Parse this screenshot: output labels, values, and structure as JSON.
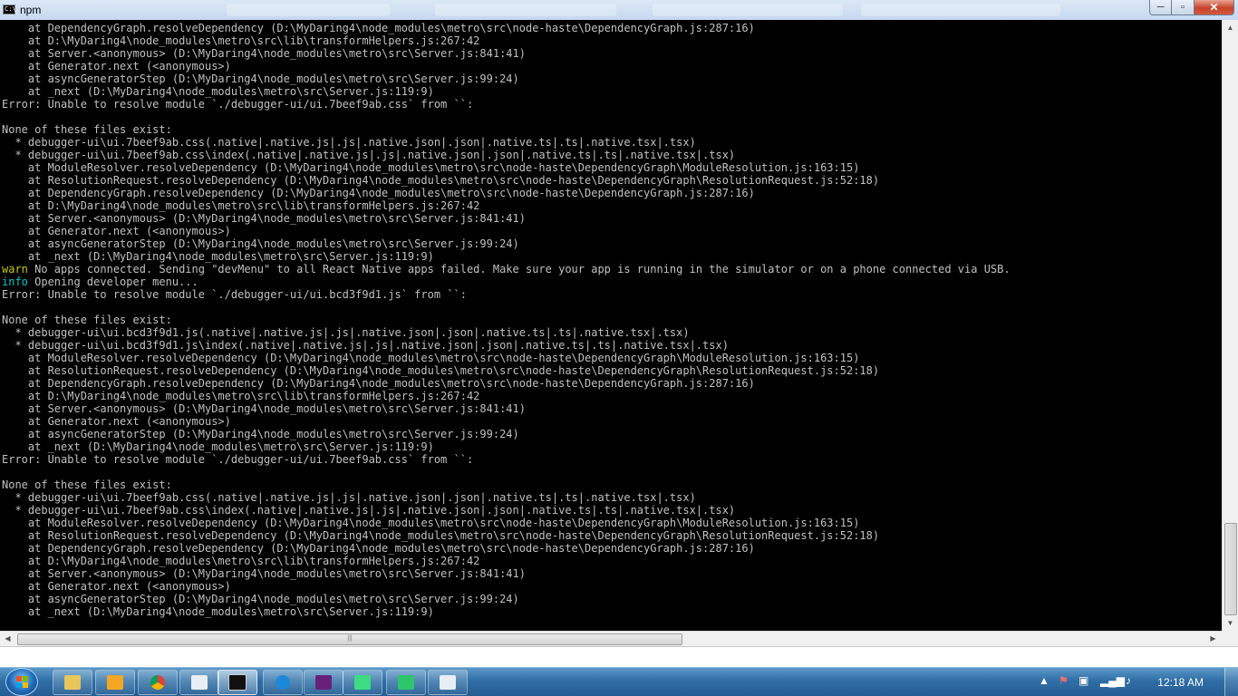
{
  "window": {
    "title": "npm",
    "icon_label": "C:\\",
    "controls": {
      "minimize": "─",
      "maximize": "▫",
      "close": "✕"
    }
  },
  "console": {
    "lines": [
      {
        "text": "    at DependencyGraph.resolveDependency (D:\\MyDaring4\\node_modules\\metro\\src\\node-haste\\DependencyGraph.js:287:16)"
      },
      {
        "text": "    at D:\\MyDaring4\\node_modules\\metro\\src\\lib\\transformHelpers.js:267:42"
      },
      {
        "text": "    at Server.<anonymous> (D:\\MyDaring4\\node_modules\\metro\\src\\Server.js:841:41)"
      },
      {
        "text": "    at Generator.next (<anonymous>)"
      },
      {
        "text": "    at asyncGeneratorStep (D:\\MyDaring4\\node_modules\\metro\\src\\Server.js:99:24)"
      },
      {
        "text": "    at _next (D:\\MyDaring4\\node_modules\\metro\\src\\Server.js:119:9)"
      },
      {
        "text": "Error: Unable to resolve module `./debugger-ui/ui.7beef9ab.css` from ``:"
      },
      {
        "text": ""
      },
      {
        "text": "None of these files exist:"
      },
      {
        "text": "  * debugger-ui\\ui.7beef9ab.css(.native|.native.js|.js|.native.json|.json|.native.ts|.ts|.native.tsx|.tsx)"
      },
      {
        "text": "  * debugger-ui\\ui.7beef9ab.css\\index(.native|.native.js|.js|.native.json|.json|.native.ts|.ts|.native.tsx|.tsx)"
      },
      {
        "text": "    at ModuleResolver.resolveDependency (D:\\MyDaring4\\node_modules\\metro\\src\\node-haste\\DependencyGraph\\ModuleResolution.js:163:15)"
      },
      {
        "text": "    at ResolutionRequest.resolveDependency (D:\\MyDaring4\\node_modules\\metro\\src\\node-haste\\DependencyGraph\\ResolutionRequest.js:52:18)"
      },
      {
        "text": "    at DependencyGraph.resolveDependency (D:\\MyDaring4\\node_modules\\metro\\src\\node-haste\\DependencyGraph.js:287:16)"
      },
      {
        "text": "    at D:\\MyDaring4\\node_modules\\metro\\src\\lib\\transformHelpers.js:267:42"
      },
      {
        "text": "    at Server.<anonymous> (D:\\MyDaring4\\node_modules\\metro\\src\\Server.js:841:41)"
      },
      {
        "text": "    at Generator.next (<anonymous>)"
      },
      {
        "text": "    at asyncGeneratorStep (D:\\MyDaring4\\node_modules\\metro\\src\\Server.js:99:24)"
      },
      {
        "text": "    at _next (D:\\MyDaring4\\node_modules\\metro\\src\\Server.js:119:9)"
      },
      {
        "tag": "warn",
        "text": " No apps connected. Sending \"devMenu\" to all React Native apps failed. Make sure your app is running in the simulator or on a phone connected via USB."
      },
      {
        "tag": "info",
        "text": " Opening developer menu..."
      },
      {
        "text": "Error: Unable to resolve module `./debugger-ui/ui.bcd3f9d1.js` from ``:"
      },
      {
        "text": ""
      },
      {
        "text": "None of these files exist:"
      },
      {
        "text": "  * debugger-ui\\ui.bcd3f9d1.js(.native|.native.js|.js|.native.json|.json|.native.ts|.ts|.native.tsx|.tsx)"
      },
      {
        "text": "  * debugger-ui\\ui.bcd3f9d1.js\\index(.native|.native.js|.js|.native.json|.json|.native.ts|.ts|.native.tsx|.tsx)"
      },
      {
        "text": "    at ModuleResolver.resolveDependency (D:\\MyDaring4\\node_modules\\metro\\src\\node-haste\\DependencyGraph\\ModuleResolution.js:163:15)"
      },
      {
        "text": "    at ResolutionRequest.resolveDependency (D:\\MyDaring4\\node_modules\\metro\\src\\node-haste\\DependencyGraph\\ResolutionRequest.js:52:18)"
      },
      {
        "text": "    at DependencyGraph.resolveDependency (D:\\MyDaring4\\node_modules\\metro\\src\\node-haste\\DependencyGraph.js:287:16)"
      },
      {
        "text": "    at D:\\MyDaring4\\node_modules\\metro\\src\\lib\\transformHelpers.js:267:42"
      },
      {
        "text": "    at Server.<anonymous> (D:\\MyDaring4\\node_modules\\metro\\src\\Server.js:841:41)"
      },
      {
        "text": "    at Generator.next (<anonymous>)"
      },
      {
        "text": "    at asyncGeneratorStep (D:\\MyDaring4\\node_modules\\metro\\src\\Server.js:99:24)"
      },
      {
        "text": "    at _next (D:\\MyDaring4\\node_modules\\metro\\src\\Server.js:119:9)"
      },
      {
        "text": "Error: Unable to resolve module `./debugger-ui/ui.7beef9ab.css` from ``:"
      },
      {
        "text": ""
      },
      {
        "text": "None of these files exist:"
      },
      {
        "text": "  * debugger-ui\\ui.7beef9ab.css(.native|.native.js|.js|.native.json|.json|.native.ts|.ts|.native.tsx|.tsx)"
      },
      {
        "text": "  * debugger-ui\\ui.7beef9ab.css\\index(.native|.native.js|.js|.native.json|.json|.native.ts|.ts|.native.tsx|.tsx)"
      },
      {
        "text": "    at ModuleResolver.resolveDependency (D:\\MyDaring4\\node_modules\\metro\\src\\node-haste\\DependencyGraph\\ModuleResolution.js:163:15)"
      },
      {
        "text": "    at ResolutionRequest.resolveDependency (D:\\MyDaring4\\node_modules\\metro\\src\\node-haste\\DependencyGraph\\ResolutionRequest.js:52:18)"
      },
      {
        "text": "    at DependencyGraph.resolveDependency (D:\\MyDaring4\\node_modules\\metro\\src\\node-haste\\DependencyGraph.js:287:16)"
      },
      {
        "text": "    at D:\\MyDaring4\\node_modules\\metro\\src\\lib\\transformHelpers.js:267:42"
      },
      {
        "text": "    at Server.<anonymous> (D:\\MyDaring4\\node_modules\\metro\\src\\Server.js:841:41)"
      },
      {
        "text": "    at Generator.next (<anonymous>)"
      },
      {
        "text": "    at asyncGeneratorStep (D:\\MyDaring4\\node_modules\\metro\\src\\Server.js:99:24)"
      },
      {
        "text": "    at _next (D:\\MyDaring4\\node_modules\\metro\\src\\Server.js:119:9)"
      }
    ],
    "colors": {
      "text": "#c0c0c0",
      "warn": "#c8c800",
      "info": "#00c8c8",
      "background": "#000000"
    }
  },
  "scrollbars": {
    "vertical_position": 0.95,
    "horizontal_position": 0.0,
    "up_arrow": "▲",
    "down_arrow": "▼",
    "left_arrow": "◀",
    "right_arrow": "▶",
    "grip": "|||"
  },
  "taskbar": {
    "buttons": [
      {
        "name": "explorer",
        "icon": "folder-icon",
        "color": "#e8c65a"
      },
      {
        "name": "media-player",
        "icon": "media-player-icon",
        "color": "#f5a623"
      },
      {
        "name": "chrome",
        "icon": "chrome-icon",
        "color": "#db4437"
      },
      {
        "name": "window",
        "icon": "window-icon",
        "color": "#e8eef5"
      },
      {
        "name": "cmd",
        "icon": "command-prompt-icon",
        "color": "#111111",
        "active": true
      },
      {
        "name": "edge",
        "icon": "edge-icon",
        "color": "#1e88d8"
      },
      {
        "name": "visual-studio",
        "icon": "visual-studio-icon",
        "color": "#68217a"
      },
      {
        "name": "android-studio",
        "icon": "android-icon",
        "color": "#3ddc84"
      },
      {
        "name": "device-manager",
        "icon": "device-icon",
        "color": "#2ec46b"
      },
      {
        "name": "window2",
        "icon": "window-icon",
        "color": "#e8eef5"
      }
    ],
    "tray": {
      "clock": "12:18 AM",
      "icons": [
        "show-hidden-icons-icon",
        "action-center-icon",
        "safely-remove-icon",
        "network-signal-icon",
        "volume-icon"
      ]
    }
  }
}
